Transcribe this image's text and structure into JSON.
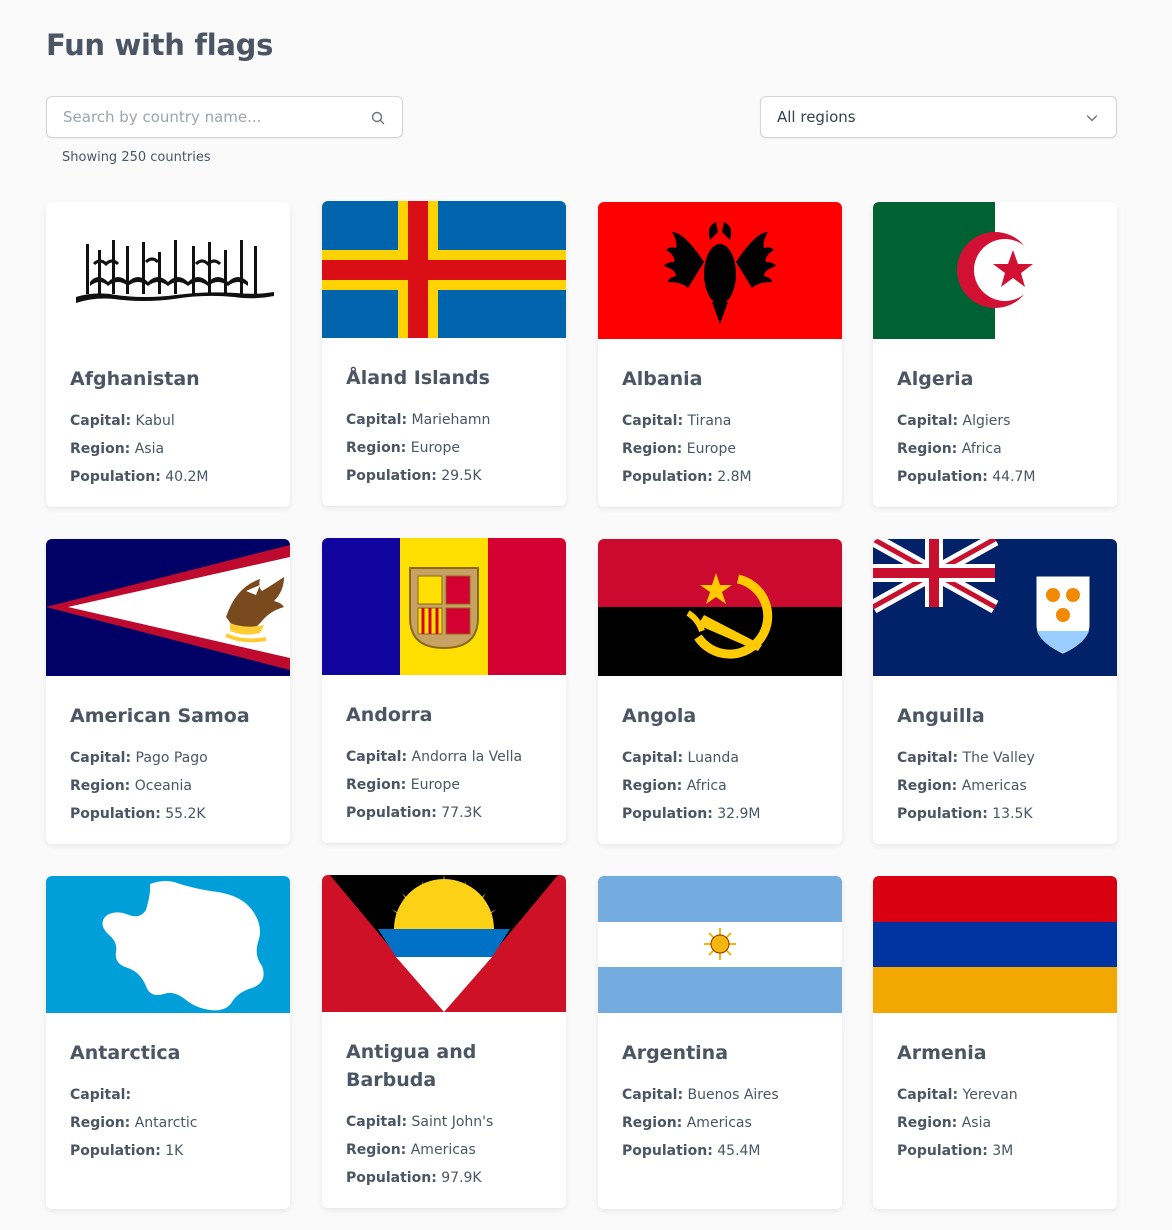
{
  "page": {
    "title": "Fun with flags"
  },
  "search": {
    "placeholder": "Search by country name..."
  },
  "filter": {
    "selected": "All regions"
  },
  "result_count": "Showing 250 countries",
  "labels": {
    "capital": "Capital:",
    "region": "Region:",
    "population": "Population:"
  },
  "countries": [
    {
      "name": "Afghanistan",
      "capital": "Kabul",
      "region": "Asia",
      "population": "40.2M",
      "flag_icon": "afghanistan-flag-icon"
    },
    {
      "name": "Åland Islands",
      "capital": "Mariehamn",
      "region": "Europe",
      "population": "29.5K",
      "flag_icon": "aland-islands-flag-icon"
    },
    {
      "name": "Albania",
      "capital": "Tirana",
      "region": "Europe",
      "population": "2.8M",
      "flag_icon": "albania-flag-icon"
    },
    {
      "name": "Algeria",
      "capital": "Algiers",
      "region": "Africa",
      "population": "44.7M",
      "flag_icon": "algeria-flag-icon"
    },
    {
      "name": "American Samoa",
      "capital": "Pago Pago",
      "region": "Oceania",
      "population": "55.2K",
      "flag_icon": "american-samoa-flag-icon"
    },
    {
      "name": "Andorra",
      "capital": "Andorra la Vella",
      "region": "Europe",
      "population": "77.3K",
      "flag_icon": "andorra-flag-icon"
    },
    {
      "name": "Angola",
      "capital": "Luanda",
      "region": "Africa",
      "population": "32.9M",
      "flag_icon": "angola-flag-icon"
    },
    {
      "name": "Anguilla",
      "capital": "The Valley",
      "region": "Americas",
      "population": "13.5K",
      "flag_icon": "anguilla-flag-icon"
    },
    {
      "name": "Antarctica",
      "capital": "",
      "region": "Antarctic",
      "population": "1K",
      "flag_icon": "antarctica-flag-icon"
    },
    {
      "name": "Antigua and Barbuda",
      "capital": "Saint John's",
      "region": "Americas",
      "population": "97.9K",
      "flag_icon": "antigua-and-barbuda-flag-icon"
    },
    {
      "name": "Argentina",
      "capital": "Buenos Aires",
      "region": "Americas",
      "population": "45.4M",
      "flag_icon": "argentina-flag-icon"
    },
    {
      "name": "Armenia",
      "capital": "Yerevan",
      "region": "Asia",
      "population": "3M",
      "flag_icon": "armenia-flag-icon"
    }
  ],
  "colors": {
    "background": "#fafafa",
    "card": "#ffffff",
    "text": "#4b5563"
  }
}
